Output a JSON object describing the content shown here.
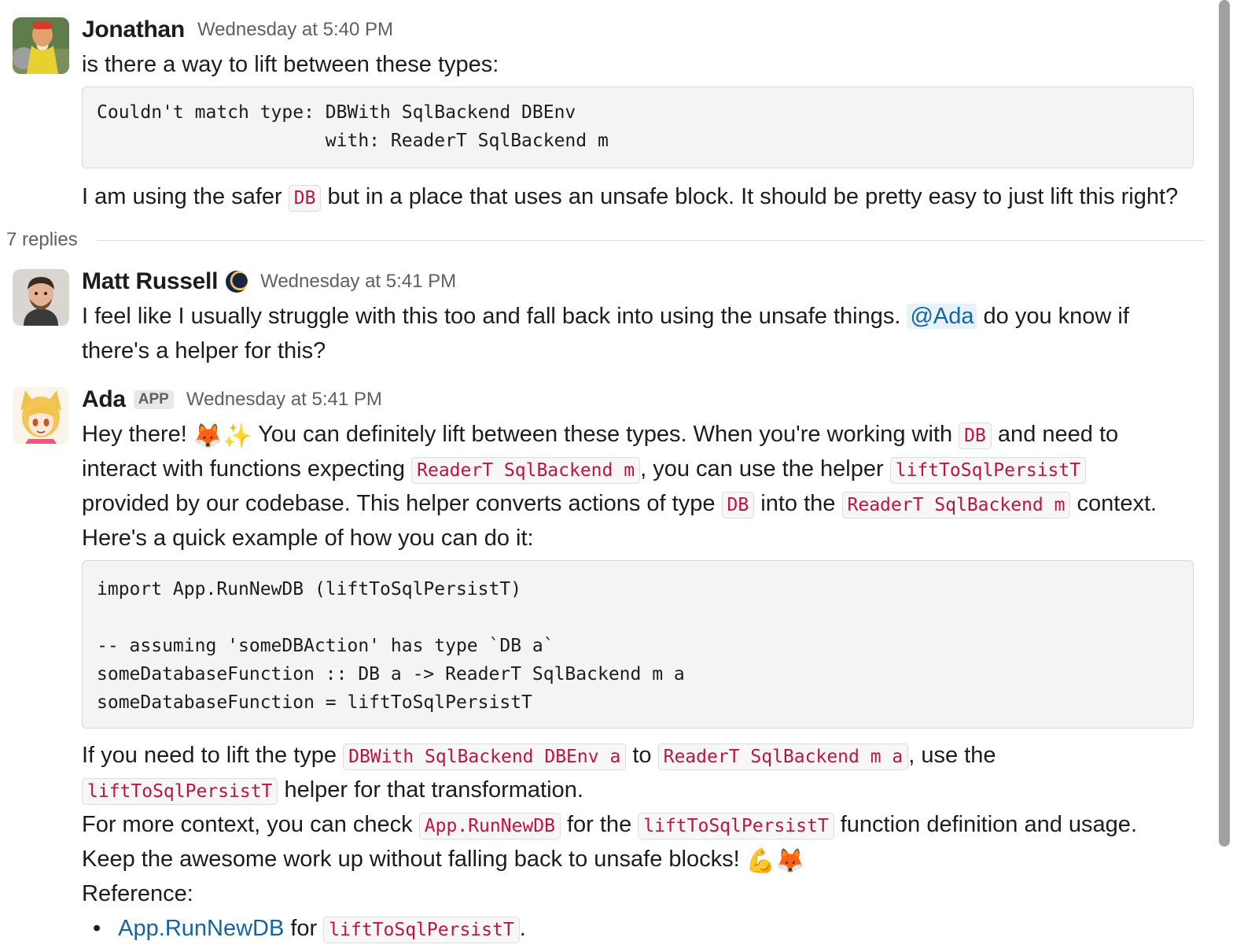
{
  "thread": {
    "replies_label": "7 replies"
  },
  "msg1": {
    "author": "Jonathan",
    "timestamp": "Wednesday at 5:40 PM",
    "line1": "is there a way to lift between these types:",
    "code": "Couldn't match type: DBWith SqlBackend DBEnv\n                     with: ReaderT SqlBackend m",
    "line2_a": "I am using the safer ",
    "line2_code": "DB",
    "line2_b": " but in a place that uses an unsafe block. It should be pretty easy to just lift this right?"
  },
  "msg2": {
    "author": "Matt Russell",
    "status_icon": "moon-emoji",
    "timestamp": "Wednesday at 5:41 PM",
    "line1_a": "I feel like I usually struggle with this too and fall back into using the unsafe things. ",
    "mention": "@Ada",
    "line1_b": " do you know if",
    "line2": "there's a helper for this?"
  },
  "msg3": {
    "author": "Ada",
    "badge": "APP",
    "timestamp": "Wednesday at 5:41 PM",
    "p1_l1_a": "Hey there! ",
    "p1_l1_emoji": "🦊✨",
    "p1_l1_b": " You can definitely lift between these types. When you're working with ",
    "p1_l1_code": "DB",
    "p1_l1_c": " and need to",
    "p1_l2_a": "interact with functions expecting ",
    "p1_l2_code1": "ReaderT SqlBackend m",
    "p1_l2_b": ", you can use the helper ",
    "p1_l2_code2": "liftToSqlPersistT",
    "p1_l3_a": "provided by our codebase. This helper converts actions of type ",
    "p1_l3_code1": "DB",
    "p1_l3_b": " into the ",
    "p1_l3_code2": "ReaderT SqlBackend m",
    "p1_l3_c": " context.",
    "p1_l4": "Here's a quick example of how you can do it:",
    "code": "import App.RunNewDB (liftToSqlPersistT)\n\n-- assuming 'someDBAction' has type `DB a`\nsomeDatabaseFunction :: DB a -> ReaderT SqlBackend m a\nsomeDatabaseFunction = liftToSqlPersistT",
    "p2_l1_a": "If you need to lift the type ",
    "p2_l1_code1": "DBWith SqlBackend DBEnv a",
    "p2_l1_b": " to ",
    "p2_l1_code2": "ReaderT SqlBackend m a",
    "p2_l1_c": ", use the",
    "p2_l2_code": "liftToSqlPersistT",
    "p2_l2_a": " helper for that transformation.",
    "p3_a": "For more context, you can check ",
    "p3_code1": "App.RunNewDB",
    "p3_b": " for the ",
    "p3_code2": "liftToSqlPersistT",
    "p3_c": " function definition and usage.",
    "p4_a": "Keep the awesome work up without falling back to unsafe blocks! ",
    "p4_emoji": "💪🦊",
    "p5": "Reference:",
    "ref_bullet": "•",
    "ref_link": "App.RunNewDB",
    "ref_a": " for ",
    "ref_code": "liftToSqlPersistT",
    "ref_b": "."
  }
}
